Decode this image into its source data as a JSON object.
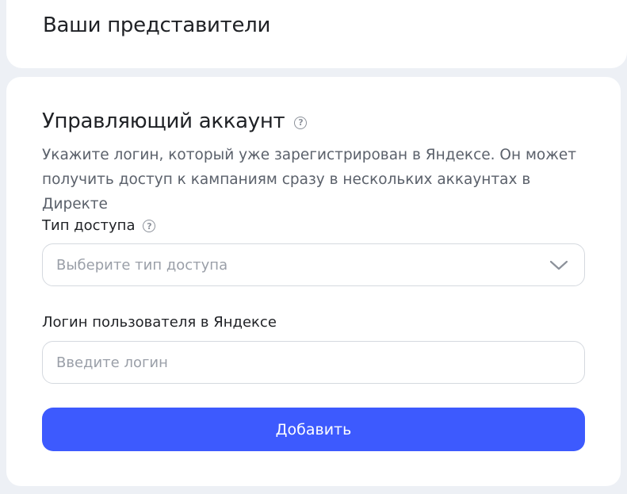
{
  "representatives_card": {
    "title": "Ваши представители"
  },
  "manager_card": {
    "title": "Управляющий аккаунт",
    "help_icon": "question-circle-icon",
    "description": "Укажите логин, который уже зарегистрирован в Яндексе. Он может получить доступ к кампаниям сразу в нескольких аккаунтах в Директе",
    "access_type": {
      "label": "Тип доступа",
      "help_icon": "question-circle-icon",
      "placeholder": "Выберите тип доступа",
      "icon": "chevron-down-icon"
    },
    "login": {
      "label": "Логин пользователя в Яндексе",
      "placeholder": "Введите логин",
      "value": ""
    },
    "add_button_label": "Добавить"
  },
  "colors": {
    "background": "#edf0f5",
    "card": "#ffffff",
    "primary_button": "#3d5afe",
    "muted_text": "#5b616b",
    "placeholder": "#9a9fa8"
  }
}
